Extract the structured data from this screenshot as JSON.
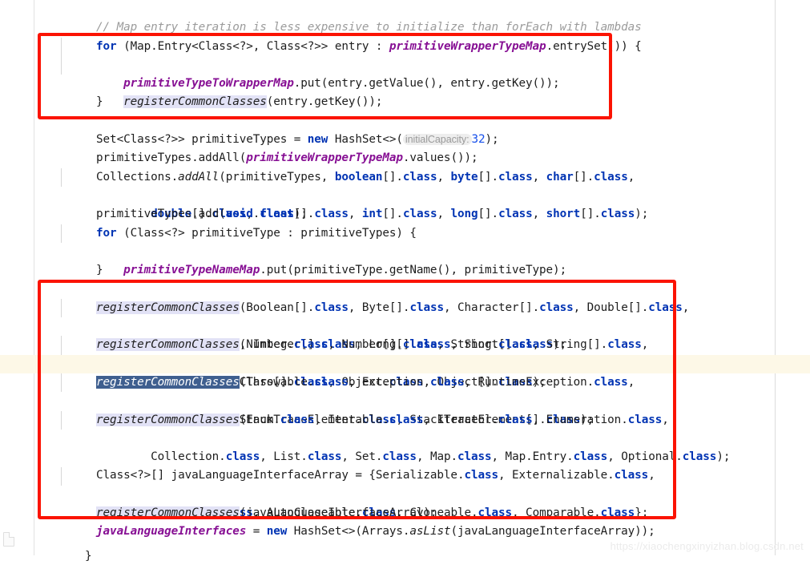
{
  "app": {
    "type": "code-editor",
    "language": "Java",
    "theme": "light",
    "colors": {
      "background": "#ffffff",
      "text": "#1d1d1d",
      "keyword": "#0033b3",
      "static_field": "#871094",
      "comment": "#9b9b9b",
      "number": "#1750eb",
      "usage_highlight": "#e2e2f6",
      "selection": "#3f5f8f",
      "current_line": "#fdf8e7",
      "annotation_box": "#fb1302",
      "gutter_line": "#e2e2e2",
      "margin_guide": "#dcdcdc",
      "watermark": "#ebebeb"
    }
  },
  "annotations": {
    "box_1_label": "red-highlight-box-map-entry-loop",
    "box_2_label": "red-highlight-box-register-common-classes"
  },
  "watermark": {
    "text": "https://xiaochengxinyizhan.blog.csdn.net"
  },
  "code": {
    "lines": [
      {
        "id": "l1",
        "text": "// Map entry iteration is less expensive to initialize than forEach with lambdas"
      },
      {
        "id": "l2",
        "text": "for (Map.Entry<Class<?>, Class<?>> entry : primitiveWrapperTypeMap.entrySet()) {"
      },
      {
        "id": "l3",
        "text": "    primitiveTypeToWrapperMap.put(entry.getValue(), entry.getKey());"
      },
      {
        "id": "l4",
        "text": "    registerCommonClasses(entry.getKey());"
      },
      {
        "id": "l5",
        "text": "}"
      },
      {
        "id": "l6",
        "text": ""
      },
      {
        "id": "l7",
        "text": "Set<Class<?>> primitiveTypes = new HashSet<>( initialCapacity: 32);"
      },
      {
        "id": "l8",
        "text": "primitiveTypes.addAll(primitiveWrapperTypeMap.values());"
      },
      {
        "id": "l9",
        "text": "Collections.addAll(primitiveTypes, boolean[].class, byte[].class, char[].class,"
      },
      {
        "id": "l10",
        "text": "        double[].class, float[].class, int[].class, long[].class, short[].class);"
      },
      {
        "id": "l11",
        "text": "primitiveTypes.add(void.class);"
      },
      {
        "id": "l12",
        "text": "for (Class<?> primitiveType : primitiveTypes) {"
      },
      {
        "id": "l13",
        "text": "    primitiveTypeNameMap.put(primitiveType.getName(), primitiveType);"
      },
      {
        "id": "l14",
        "text": "}"
      },
      {
        "id": "l15",
        "text": ""
      },
      {
        "id": "l16",
        "text": "registerCommonClasses(Boolean[].class, Byte[].class, Character[].class, Double[].class,"
      },
      {
        "id": "l17",
        "text": "        Float[].class, Integer[].class, Long[].class, Short[].class);"
      },
      {
        "id": "l18",
        "text": "registerCommonClasses(Number.class, Number[].class, String.class, String[].class,"
      },
      {
        "id": "l19",
        "text": "        Class.class, Class[].class, Object.class, Object[].class);"
      },
      {
        "id": "l20",
        "text": "registerCommonClasses(Throwable.class, Exception.class, RuntimeException.class,"
      },
      {
        "id": "l21",
        "text": "        Error.class, StackTraceElement.class, StackTraceElement[].class);"
      },
      {
        "id": "l22",
        "text": "registerCommonClasses(Enum.class, Iterable.class, Iterator.class, Enumeration.class,"
      },
      {
        "id": "l23",
        "text": "        Collection.class, List.class, Set.class, Map.class, Map.Entry.class, Optional.class);"
      },
      {
        "id": "l24",
        "text": ""
      },
      {
        "id": "l25",
        "text": "Class<?>[] javaLanguageInterfaceArray = {Serializable.class, Externalizable.class,"
      },
      {
        "id": "l26",
        "text": "        Closeable.class, AutoCloseable.class, Cloneable.class, Comparable.class};"
      },
      {
        "id": "l27",
        "text": "registerCommonClasses(javaLanguageInterfaceArray);"
      },
      {
        "id": "l28",
        "text": "javaLanguageInterfaces = new HashSet<>(Arrays.asList(javaLanguageInterfaceArray));"
      },
      {
        "id": "l29",
        "text": "}"
      }
    ],
    "parameter_hint": {
      "name": "initialCapacity:",
      "value": "32"
    },
    "selected_token": "registerCommonClasses",
    "highlighted_identifier": "registerCommonClasses",
    "current_line_id": "l20"
  }
}
